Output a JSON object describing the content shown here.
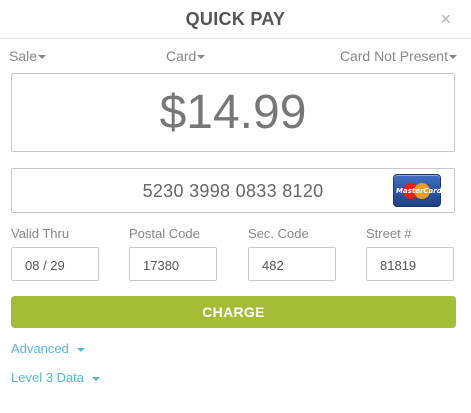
{
  "header": {
    "title": "QUICK PAY",
    "close_label": "×"
  },
  "dropdowns": {
    "transaction_type": "Sale",
    "payment_method": "Card",
    "entry_mode": "Card Not Present"
  },
  "amount": "$14.99",
  "card": {
    "number": "5230 3998 0833 8120",
    "brand_icon": "mastercard-icon",
    "brand_label": "MasterCard"
  },
  "fields": [
    {
      "label": "Valid Thru",
      "value": "08 / 29"
    },
    {
      "label": "Postal Code",
      "value": "17380"
    },
    {
      "label": "Sec. Code",
      "value": "482"
    },
    {
      "label": "Street #",
      "value": "81819"
    }
  ],
  "charge_label": "CHARGE",
  "links": {
    "advanced": "Advanced",
    "level3": "Level 3 Data"
  },
  "colors": {
    "accent": "#a4bd36",
    "link": "#5bb6d6"
  }
}
